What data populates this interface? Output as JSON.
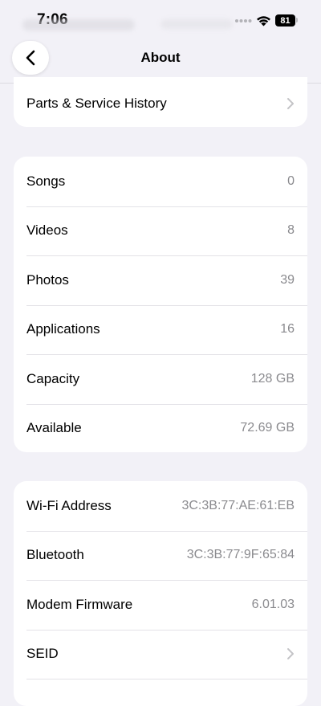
{
  "status_bar": {
    "time": "7:06",
    "battery": "81"
  },
  "nav": {
    "title": "About",
    "back_icon": "chevron-left-icon"
  },
  "card_parts": {
    "rows": [
      {
        "label": "Parts & Service History",
        "value": "",
        "chevron": true
      }
    ]
  },
  "card_media": {
    "rows": [
      {
        "label": "Songs",
        "value": "0"
      },
      {
        "label": "Videos",
        "value": "8"
      },
      {
        "label": "Photos",
        "value": "39"
      },
      {
        "label": "Applications",
        "value": "16"
      },
      {
        "label": "Capacity",
        "value": "128 GB"
      },
      {
        "label": "Available",
        "value": "72.69 GB"
      }
    ]
  },
  "card_network": {
    "rows": [
      {
        "label": "Wi-Fi Address",
        "value": "3C:3B:77:AE:61:EB"
      },
      {
        "label": "Bluetooth",
        "value": "3C:3B:77:9F:65:84"
      },
      {
        "label": "Modem Firmware",
        "value": "6.01.03"
      },
      {
        "label": "SEID",
        "value": "",
        "chevron": true
      }
    ]
  },
  "colors": {
    "background": "#F2F1F7",
    "card": "#FFFFFF",
    "secondary_text": "#8A8A8E"
  }
}
